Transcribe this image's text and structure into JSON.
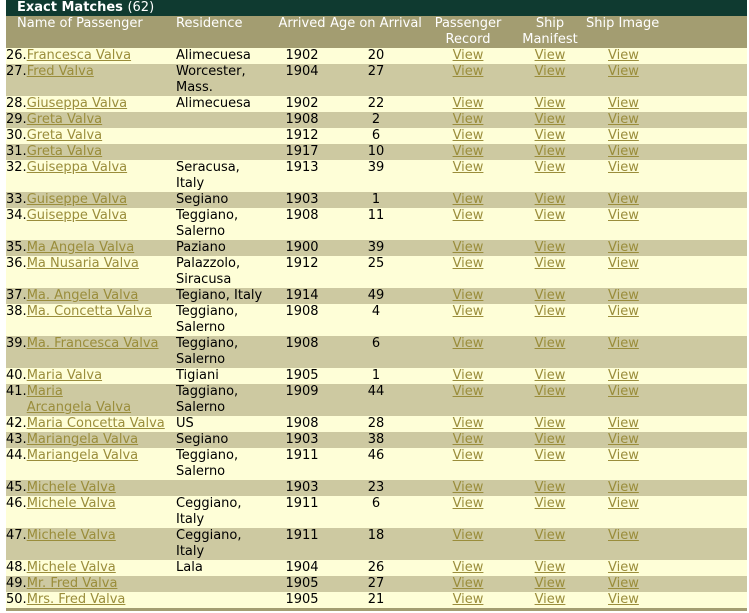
{
  "header": {
    "title": "Exact Matches",
    "count": "(62)"
  },
  "columns": {
    "name": "Name of Passenger",
    "residence": "Residence",
    "arrived": "Arrived",
    "age": "Age on Arrival",
    "record": [
      "Passenger",
      "Record"
    ],
    "manifest": [
      "Ship",
      "Manifest"
    ],
    "image": "Ship Image"
  },
  "view_label": "View",
  "rows": [
    {
      "num": "26.",
      "name": [
        "Francesca Valva"
      ],
      "residence": [
        "Alimecuesa"
      ],
      "year": "1902",
      "age": "20"
    },
    {
      "num": "27.",
      "name": [
        "Fred Valva"
      ],
      "residence": [
        "Worcester,",
        "Mass."
      ],
      "year": "1904",
      "age": "27"
    },
    {
      "num": "28.",
      "name": [
        "Giuseppa Valva"
      ],
      "residence": [
        "Alimecuesa"
      ],
      "year": "1902",
      "age": "22"
    },
    {
      "num": "29.",
      "name": [
        "Greta Valva"
      ],
      "residence": [
        ""
      ],
      "year": "1908",
      "age": "2"
    },
    {
      "num": "30.",
      "name": [
        "Greta Valva"
      ],
      "residence": [
        ""
      ],
      "year": "1912",
      "age": "6"
    },
    {
      "num": "31.",
      "name": [
        "Greta Valva"
      ],
      "residence": [
        ""
      ],
      "year": "1917",
      "age": "10"
    },
    {
      "num": "32.",
      "name": [
        "Guiseppa Valva"
      ],
      "residence": [
        "Seracusa,",
        "Italy"
      ],
      "year": "1913",
      "age": "39"
    },
    {
      "num": "33.",
      "name": [
        "Guiseppe Valva"
      ],
      "residence": [
        "Segiano"
      ],
      "year": "1903",
      "age": "1"
    },
    {
      "num": "34.",
      "name": [
        "Guiseppe Valva"
      ],
      "residence": [
        "Teggiano,",
        "Salerno"
      ],
      "year": "1908",
      "age": "11"
    },
    {
      "num": "35.",
      "name": [
        "Ma Angela Valva"
      ],
      "residence": [
        "Paziano"
      ],
      "year": "1900",
      "age": "39"
    },
    {
      "num": "36.",
      "name": [
        "Ma Nusaria Valva"
      ],
      "residence": [
        "Palazzolo,",
        "Siracusa"
      ],
      "year": "1912",
      "age": "25"
    },
    {
      "num": "37.",
      "name": [
        "Ma. Angela Valva"
      ],
      "residence": [
        "Tegiano, Italy"
      ],
      "year": "1914",
      "age": "49"
    },
    {
      "num": "38.",
      "name": [
        "Ma. Concetta Valva"
      ],
      "residence": [
        "Teggiano,",
        "Salerno"
      ],
      "year": "1908",
      "age": "4"
    },
    {
      "num": "39.",
      "name": [
        "Ma. Francesca Valva"
      ],
      "residence": [
        "Teggiano,",
        "Salerno"
      ],
      "year": "1908",
      "age": "6"
    },
    {
      "num": "40.",
      "name": [
        "Maria Valva"
      ],
      "residence": [
        "Tigiani"
      ],
      "year": "1905",
      "age": "1"
    },
    {
      "num": "41.",
      "name": [
        "Maria",
        "Arcangela Valva"
      ],
      "residence": [
        "Taggiano,",
        "Salerno"
      ],
      "year": "1909",
      "age": "44"
    },
    {
      "num": "42.",
      "name": [
        "Maria Concetta Valva"
      ],
      "residence": [
        "US"
      ],
      "year": "1908",
      "age": "28"
    },
    {
      "num": "43.",
      "name": [
        "Mariangela Valva"
      ],
      "residence": [
        "Segiano"
      ],
      "year": "1903",
      "age": "38"
    },
    {
      "num": "44.",
      "name": [
        "Mariangela Valva"
      ],
      "residence": [
        "Teggiano,",
        "Salerno"
      ],
      "year": "1911",
      "age": "46"
    },
    {
      "num": "45.",
      "name": [
        "Michele Valva"
      ],
      "residence": [
        ""
      ],
      "year": "1903",
      "age": "23"
    },
    {
      "num": "46.",
      "name": [
        "Michele Valva"
      ],
      "residence": [
        "Ceggiano,",
        "Italy"
      ],
      "year": "1911",
      "age": "6"
    },
    {
      "num": "47.",
      "name": [
        "Michele Valva"
      ],
      "residence": [
        "Ceggiano,",
        "Italy"
      ],
      "year": "1911",
      "age": "18"
    },
    {
      "num": "48.",
      "name": [
        "Michele Valva"
      ],
      "residence": [
        "Lala"
      ],
      "year": "1904",
      "age": "26"
    },
    {
      "num": "49.",
      "name": [
        "Mr. Fred Valva"
      ],
      "residence": [
        ""
      ],
      "year": "1905",
      "age": "27"
    },
    {
      "num": "50.",
      "name": [
        "Mrs. Fred Valva"
      ],
      "residence": [
        ""
      ],
      "year": "1905",
      "age": "21"
    }
  ],
  "colors": {
    "title_bg": "#0f3a30",
    "header_bg": "#a39d71",
    "row_odd": "#cdc9a1",
    "row_even": "#fefed7",
    "link": "#9a8d3b"
  }
}
